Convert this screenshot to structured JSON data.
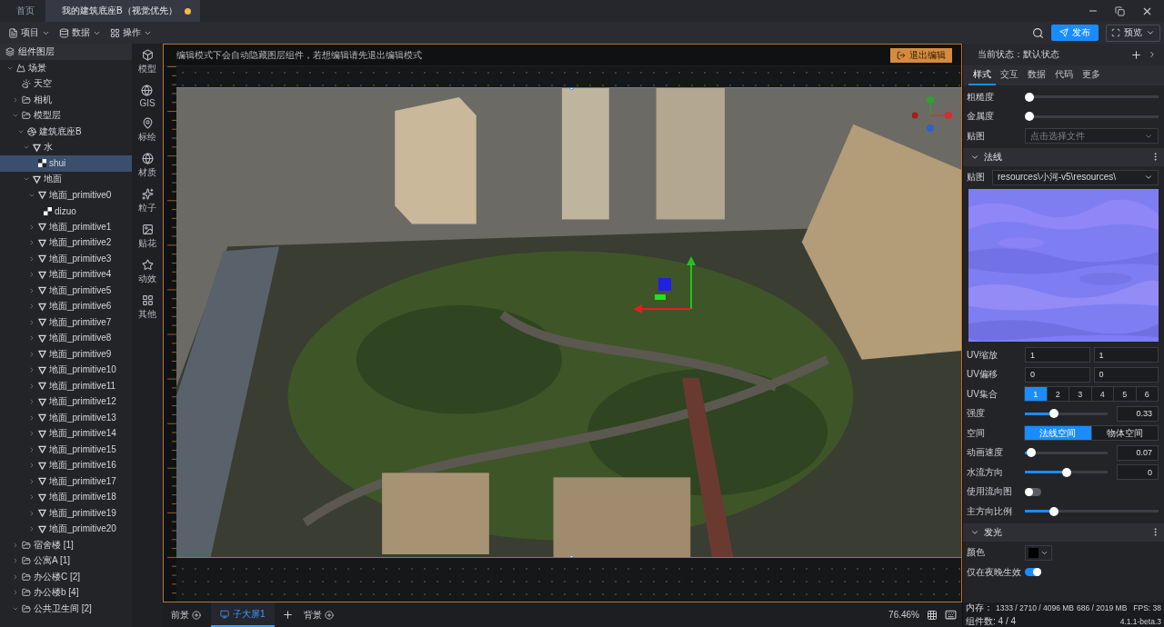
{
  "tabs": [
    {
      "label": "首页",
      "selected": false,
      "unsaved": false
    },
    {
      "label": "我的建筑底座B（视觉优先）",
      "selected": true,
      "unsaved": true
    }
  ],
  "menus": [
    "项目",
    "数据",
    "操作"
  ],
  "toolbar": {
    "publish": "发布",
    "preview": "预览"
  },
  "layers": {
    "title": "组件图层",
    "tree": [
      {
        "label": "场景",
        "kind": "scene",
        "expanded": true,
        "selected": false,
        "children": [
          {
            "label": "天空",
            "kind": "sky",
            "selected": false
          },
          {
            "label": "相机",
            "kind": "folder",
            "expanded": false,
            "selected": false
          },
          {
            "label": "模型层",
            "kind": "folder",
            "expanded": true,
            "selected": false,
            "children": [
              {
                "label": "建筑底座B",
                "kind": "model",
                "expanded": true,
                "selected": false,
                "children": [
                  {
                    "label": "水",
                    "kind": "mesh",
                    "expanded": true,
                    "selected": false,
                    "children": [
                      {
                        "label": "shui",
                        "kind": "texture",
                        "selected": true
                      }
                    ]
                  },
                  {
                    "label": "地面",
                    "kind": "mesh",
                    "expanded": true,
                    "selected": false,
                    "children": [
                      {
                        "label": "地面_primitive0",
                        "kind": "mesh",
                        "expanded": true,
                        "selected": false,
                        "children": [
                          {
                            "label": "dizuo",
                            "kind": "texture",
                            "selected": false
                          }
                        ]
                      },
                      {
                        "label": "地面_primitive1",
                        "kind": "mesh",
                        "expanded": false,
                        "selected": false
                      },
                      {
                        "label": "地面_primitive2",
                        "kind": "mesh",
                        "expanded": false,
                        "selected": false
                      },
                      {
                        "label": "地面_primitive3",
                        "kind": "mesh",
                        "expanded": false,
                        "selected": false
                      },
                      {
                        "label": "地面_primitive4",
                        "kind": "mesh",
                        "expanded": false,
                        "selected": false
                      },
                      {
                        "label": "地面_primitive5",
                        "kind": "mesh",
                        "expanded": false,
                        "selected": false
                      },
                      {
                        "label": "地面_primitive6",
                        "kind": "mesh",
                        "expanded": false,
                        "selected": false
                      },
                      {
                        "label": "地面_primitive7",
                        "kind": "mesh",
                        "expanded": false,
                        "selected": false
                      },
                      {
                        "label": "地面_primitive8",
                        "kind": "mesh",
                        "expanded": false,
                        "selected": false
                      },
                      {
                        "label": "地面_primitive9",
                        "kind": "mesh",
                        "expanded": false,
                        "selected": false
                      },
                      {
                        "label": "地面_primitive10",
                        "kind": "mesh",
                        "expanded": false,
                        "selected": false
                      },
                      {
                        "label": "地面_primitive11",
                        "kind": "mesh",
                        "expanded": false,
                        "selected": false
                      },
                      {
                        "label": "地面_primitive12",
                        "kind": "mesh",
                        "expanded": false,
                        "selected": false
                      },
                      {
                        "label": "地面_primitive13",
                        "kind": "mesh",
                        "expanded": false,
                        "selected": false
                      },
                      {
                        "label": "地面_primitive14",
                        "kind": "mesh",
                        "expanded": false,
                        "selected": false
                      },
                      {
                        "label": "地面_primitive15",
                        "kind": "mesh",
                        "expanded": false,
                        "selected": false
                      },
                      {
                        "label": "地面_primitive16",
                        "kind": "mesh",
                        "expanded": false,
                        "selected": false
                      },
                      {
                        "label": "地面_primitive17",
                        "kind": "mesh",
                        "expanded": false,
                        "selected": false
                      },
                      {
                        "label": "地面_primitive18",
                        "kind": "mesh",
                        "expanded": false,
                        "selected": false
                      },
                      {
                        "label": "地面_primitive19",
                        "kind": "mesh",
                        "expanded": false,
                        "selected": false
                      },
                      {
                        "label": "地面_primitive20",
                        "kind": "mesh",
                        "expanded": false,
                        "selected": false
                      }
                    ]
                  }
                ]
              }
            ]
          },
          {
            "label": "宿舍楼 [1]",
            "kind": "folder",
            "expanded": false,
            "selected": false
          },
          {
            "label": "公寓A [1]",
            "kind": "folder",
            "expanded": false,
            "selected": false
          },
          {
            "label": "办公楼C [2]",
            "kind": "folder",
            "expanded": false,
            "selected": false
          },
          {
            "label": "办公楼b [4]",
            "kind": "folder",
            "expanded": false,
            "selected": false
          },
          {
            "label": "公共卫生间 [2]",
            "kind": "folder",
            "expanded": true,
            "selected": false
          }
        ]
      }
    ]
  },
  "palette": [
    "模型",
    "GIS",
    "标绘",
    "材质",
    "粒子",
    "贴花",
    "动效",
    "其他"
  ],
  "canvas": {
    "notice": "编辑模式下会自动隐藏图层组件，若想编辑请先退出编辑模式",
    "exit_button": "退出编辑",
    "bottom": {
      "foreground": "前景",
      "screens": [
        {
          "label": "子大屏1",
          "selected": true
        }
      ],
      "background": "背景",
      "zoom": "76.46%"
    }
  },
  "inspector": {
    "state_label": "当前状态：默认状态",
    "tabs": [
      {
        "label": "样式",
        "selected": true
      },
      {
        "label": "交互",
        "selected": false
      },
      {
        "label": "数据",
        "selected": false
      },
      {
        "label": "代码",
        "selected": false
      },
      {
        "label": "更多",
        "selected": false
      }
    ],
    "rows": [
      {
        "kind": "slider",
        "label": "粗糙度",
        "level": 0
      },
      {
        "kind": "slider",
        "label": "金属度",
        "level": 0
      },
      {
        "kind": "select",
        "label": "贴图",
        "placeholder": "点击选择文件"
      }
    ],
    "sections": [
      {
        "title": "法线",
        "expanded": true,
        "rows": [
          {
            "kind": "select",
            "label": "贴图",
            "value": "resources\\小河-v5\\resources\\"
          },
          {
            "kind": "picture"
          },
          {
            "kind": "pair",
            "label": "UV缩放",
            "values": [
              "1",
              "1"
            ]
          },
          {
            "kind": "pair",
            "label": "UV偏移",
            "values": [
              "0",
              "0"
            ]
          },
          {
            "kind": "segmented",
            "label": "UV集合",
            "options": [
              {
                "label": "1",
                "selected": true
              },
              {
                "label": "2",
                "selected": false
              },
              {
                "label": "3",
                "selected": false
              },
              {
                "label": "4",
                "selected": false
              },
              {
                "label": "5",
                "selected": false
              },
              {
                "label": "6",
                "selected": false
              }
            ]
          },
          {
            "kind": "slider",
            "label": "强度",
            "level": 0.33,
            "value": "0.33"
          },
          {
            "kind": "segmented",
            "label": "空间",
            "options": [
              {
                "label": "法线空间",
                "selected": true
              },
              {
                "label": "物体空间",
                "selected": false
              }
            ]
          },
          {
            "kind": "slider",
            "label": "动画速度",
            "level": 0.02,
            "value": "0.07"
          },
          {
            "kind": "slider",
            "label": "水流方向",
            "level": 0.5,
            "value": "0"
          },
          {
            "kind": "toggle",
            "label": "使用流向图",
            "on": false
          },
          {
            "kind": "slider",
            "label": "主方向比例",
            "level": 0.2
          }
        ]
      },
      {
        "title": "发光",
        "expanded": true,
        "rows": [
          {
            "kind": "color",
            "label": "颜色",
            "color": "#000000"
          },
          {
            "kind": "toggle",
            "label": "仅在夜晚生效",
            "on": true
          }
        ]
      }
    ]
  },
  "status": {
    "memory_label": "内存：",
    "memory_values": [
      "1333 / 2710 / 4096 MB",
      "686 / 2019 MB"
    ],
    "fps": "FPS: 38",
    "count": "组件数: 4 / 4",
    "version": "4.1.1-beta.3"
  }
}
